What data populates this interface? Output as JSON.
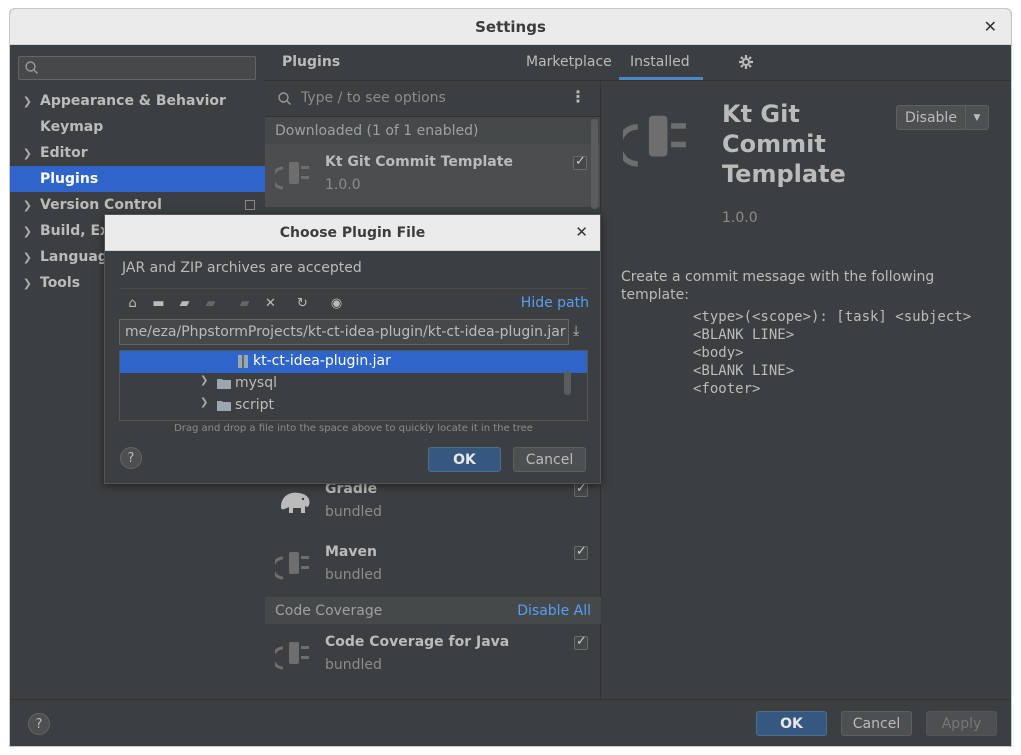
{
  "window": {
    "title": "Settings"
  },
  "sidebar": {
    "search_placeholder": "",
    "items": [
      {
        "label": "Appearance & Behavior",
        "expandable": true
      },
      {
        "label": "Keymap",
        "expandable": false
      },
      {
        "label": "Editor",
        "expandable": true
      },
      {
        "label": "Plugins",
        "expandable": false,
        "selected": true
      },
      {
        "label": "Version Control",
        "expandable": true
      },
      {
        "label": "Build, Exe",
        "expandable": true
      },
      {
        "label": "Language",
        "expandable": true
      },
      {
        "label": "Tools",
        "expandable": true
      }
    ]
  },
  "plugins": {
    "title": "Plugins",
    "tabs": [
      "Marketplace",
      "Installed"
    ],
    "active_tab": "Installed",
    "search_placeholder": "Type / to see options",
    "groups": [
      {
        "header": "Downloaded (1 of 1 enabled)",
        "items": [
          {
            "name": "Kt Git Commit Template",
            "version": "1.0.0",
            "enabled": true
          }
        ]
      },
      {
        "header": "",
        "items": [
          {
            "name": "Gradle",
            "version": "bundled",
            "enabled": true
          },
          {
            "name": "Maven",
            "version": "bundled",
            "enabled": true
          }
        ]
      },
      {
        "header": "Code Coverage",
        "action": "Disable All",
        "items": [
          {
            "name": "Code Coverage for Java",
            "version": "bundled",
            "enabled": true
          }
        ]
      }
    ]
  },
  "detail": {
    "name": "Kt Git Commit Template",
    "version": "1.0.0",
    "disable_label": "Disable",
    "description": "Create a commit message with the following template:",
    "template_lines": [
      "<type>(<scope>): [task] <subject>",
      "<BLANK LINE>",
      "<body>",
      "<BLANK LINE>",
      "<footer>"
    ]
  },
  "footer": {
    "ok": "OK",
    "cancel": "Cancel",
    "apply": "Apply",
    "help": "?"
  },
  "dialog": {
    "title": "Choose Plugin File",
    "message": "JAR and ZIP archives are accepted",
    "hide_path": "Hide path",
    "path": "me/eza/PhpstormProjects/kt-ct-idea-plugin/kt-ct-idea-plugin.jar",
    "tree": [
      {
        "label": "kt-ct-idea-plugin.jar",
        "type": "jar",
        "selected": true
      },
      {
        "label": "mysql",
        "type": "folder"
      },
      {
        "label": "script",
        "type": "folder"
      }
    ],
    "hint": "Drag and drop a file into the space above to quickly locate it in the tree",
    "ok": "OK",
    "cancel": "Cancel",
    "help": "?"
  },
  "colors": {
    "accent": "#2f65ca",
    "link": "#589df6",
    "primary_button": "#365880",
    "background": "#3c3f41"
  }
}
